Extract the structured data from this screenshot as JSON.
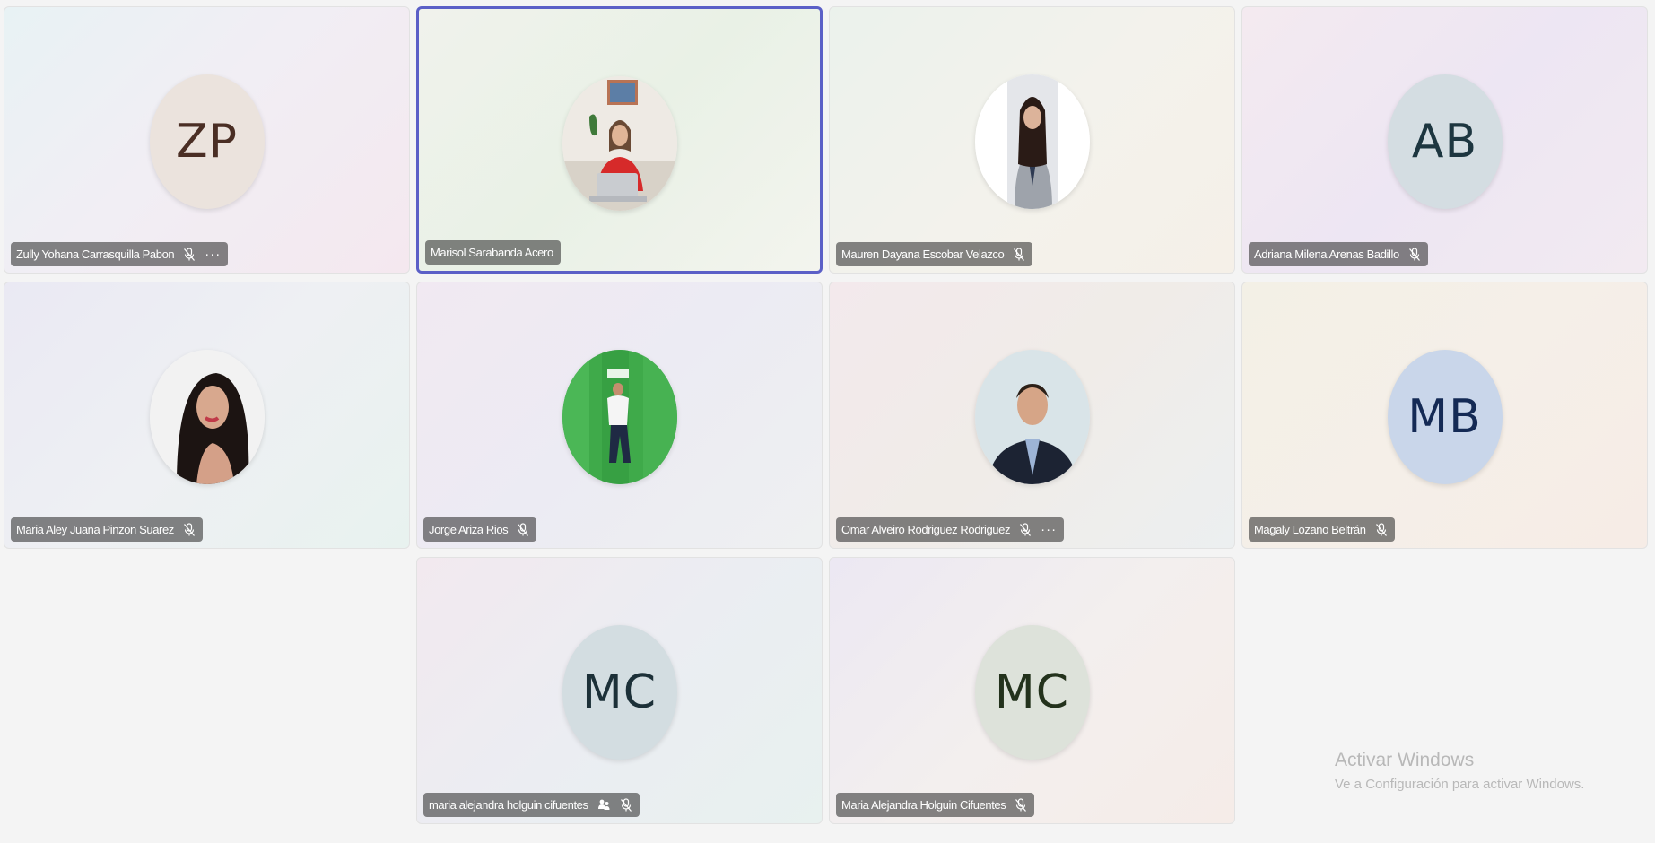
{
  "participants": [
    {
      "name": "Zully Yohana Carrasquilla Pabon",
      "initials": "ZP",
      "avatar_bg": "#ebe3dd",
      "initials_color": "#4a2e24",
      "muted": true,
      "more": true
    },
    {
      "name": "Marisol Sarabanda Acero",
      "avatar_type": "photo",
      "muted": false,
      "active": true
    },
    {
      "name": "Mauren Dayana Escobar Velazco",
      "avatar_type": "photo",
      "muted": true
    },
    {
      "name": "Adriana Milena Arenas Badillo",
      "initials": "AB",
      "avatar_bg": "#d4dde2",
      "initials_color": "#1d3640",
      "muted": true
    },
    {
      "name": "Maria Aley Juana Pinzon Suarez",
      "avatar_type": "photo",
      "muted": true
    },
    {
      "name": "Jorge Ariza Rios",
      "avatar_type": "photo",
      "muted": true
    },
    {
      "name": "Omar Alveiro Rodriguez Rodriguez",
      "avatar_type": "photo",
      "muted": true,
      "more": true
    },
    {
      "name": "Magaly Lozano Beltrán",
      "initials": "MB",
      "avatar_bg": "#c9d6ea",
      "initials_color": "#142a55",
      "muted": true
    },
    {
      "name": "maria alejandra holguin cifuentes",
      "initials": "MC",
      "avatar_bg": "#d3dde1",
      "initials_color": "#1c3038",
      "muted": true,
      "raised_hand": true
    },
    {
      "name": "Maria Alejandra Holguin Cifuentes",
      "initials": "MC",
      "avatar_bg": "#dde2da",
      "initials_color": "#23321c",
      "muted": true
    }
  ],
  "watermark": {
    "title": "Activar Windows",
    "subtitle": "Ve a Configuración para activar Windows."
  },
  "accent_color": "#5b5fc7"
}
